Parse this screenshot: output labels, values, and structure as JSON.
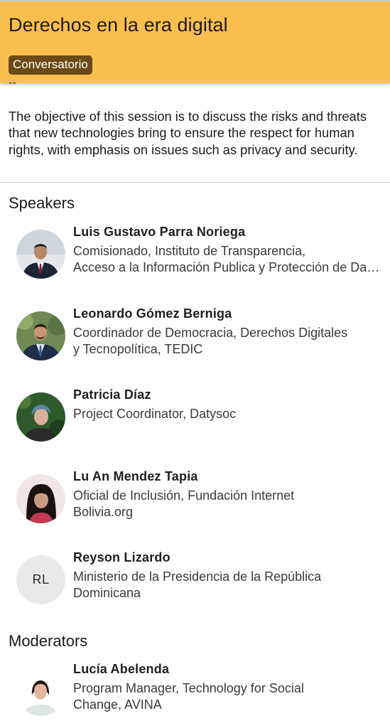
{
  "header": {
    "title": "Derechos en la era digital",
    "tag": "Conversatorio",
    "background_color": "#fbbf4f",
    "tag_color": "#6b4a16"
  },
  "separator_mark": "--",
  "description": "The objective of this session is to discuss the risks and threats that new technologies bring to ensure the respect for human rights, with emphasis on issues such as privacy and security.",
  "speakers_title": "Speakers",
  "speakers": [
    {
      "name": "Luis Gustavo Parra Noriega",
      "role_line1": "Comisionado, Instituto de Transparencia,",
      "role_line2": "Acceso a la Información Publica y Protección de Datos Personales"
    },
    {
      "name": "Leonardo Gómez Berniga",
      "role_line1": "Coordinador de Democracia, Derechos Digitales",
      "role_line2": "y Tecnopolítica, TEDIC"
    },
    {
      "name": "Patricia Díaz",
      "role_line1": "Project Coordinator, Datysoc",
      "role_line2": ""
    },
    {
      "name": "Lu An Mendez Tapia",
      "role_line1": "Oficial de Inclusión, Fundación Internet",
      "role_line2": "Bolivia.org"
    },
    {
      "name": "Reyson Lizardo",
      "initials": "RL",
      "role_line1": "Ministerio de la Presidencia de la República",
      "role_line2": "Dominicana"
    }
  ],
  "moderators_title": "Moderators",
  "moderators": [
    {
      "name": "Lucía Abelenda",
      "role_line1": "Program Manager, Technology for Social",
      "role_line2": "Change, AVINA"
    }
  ]
}
